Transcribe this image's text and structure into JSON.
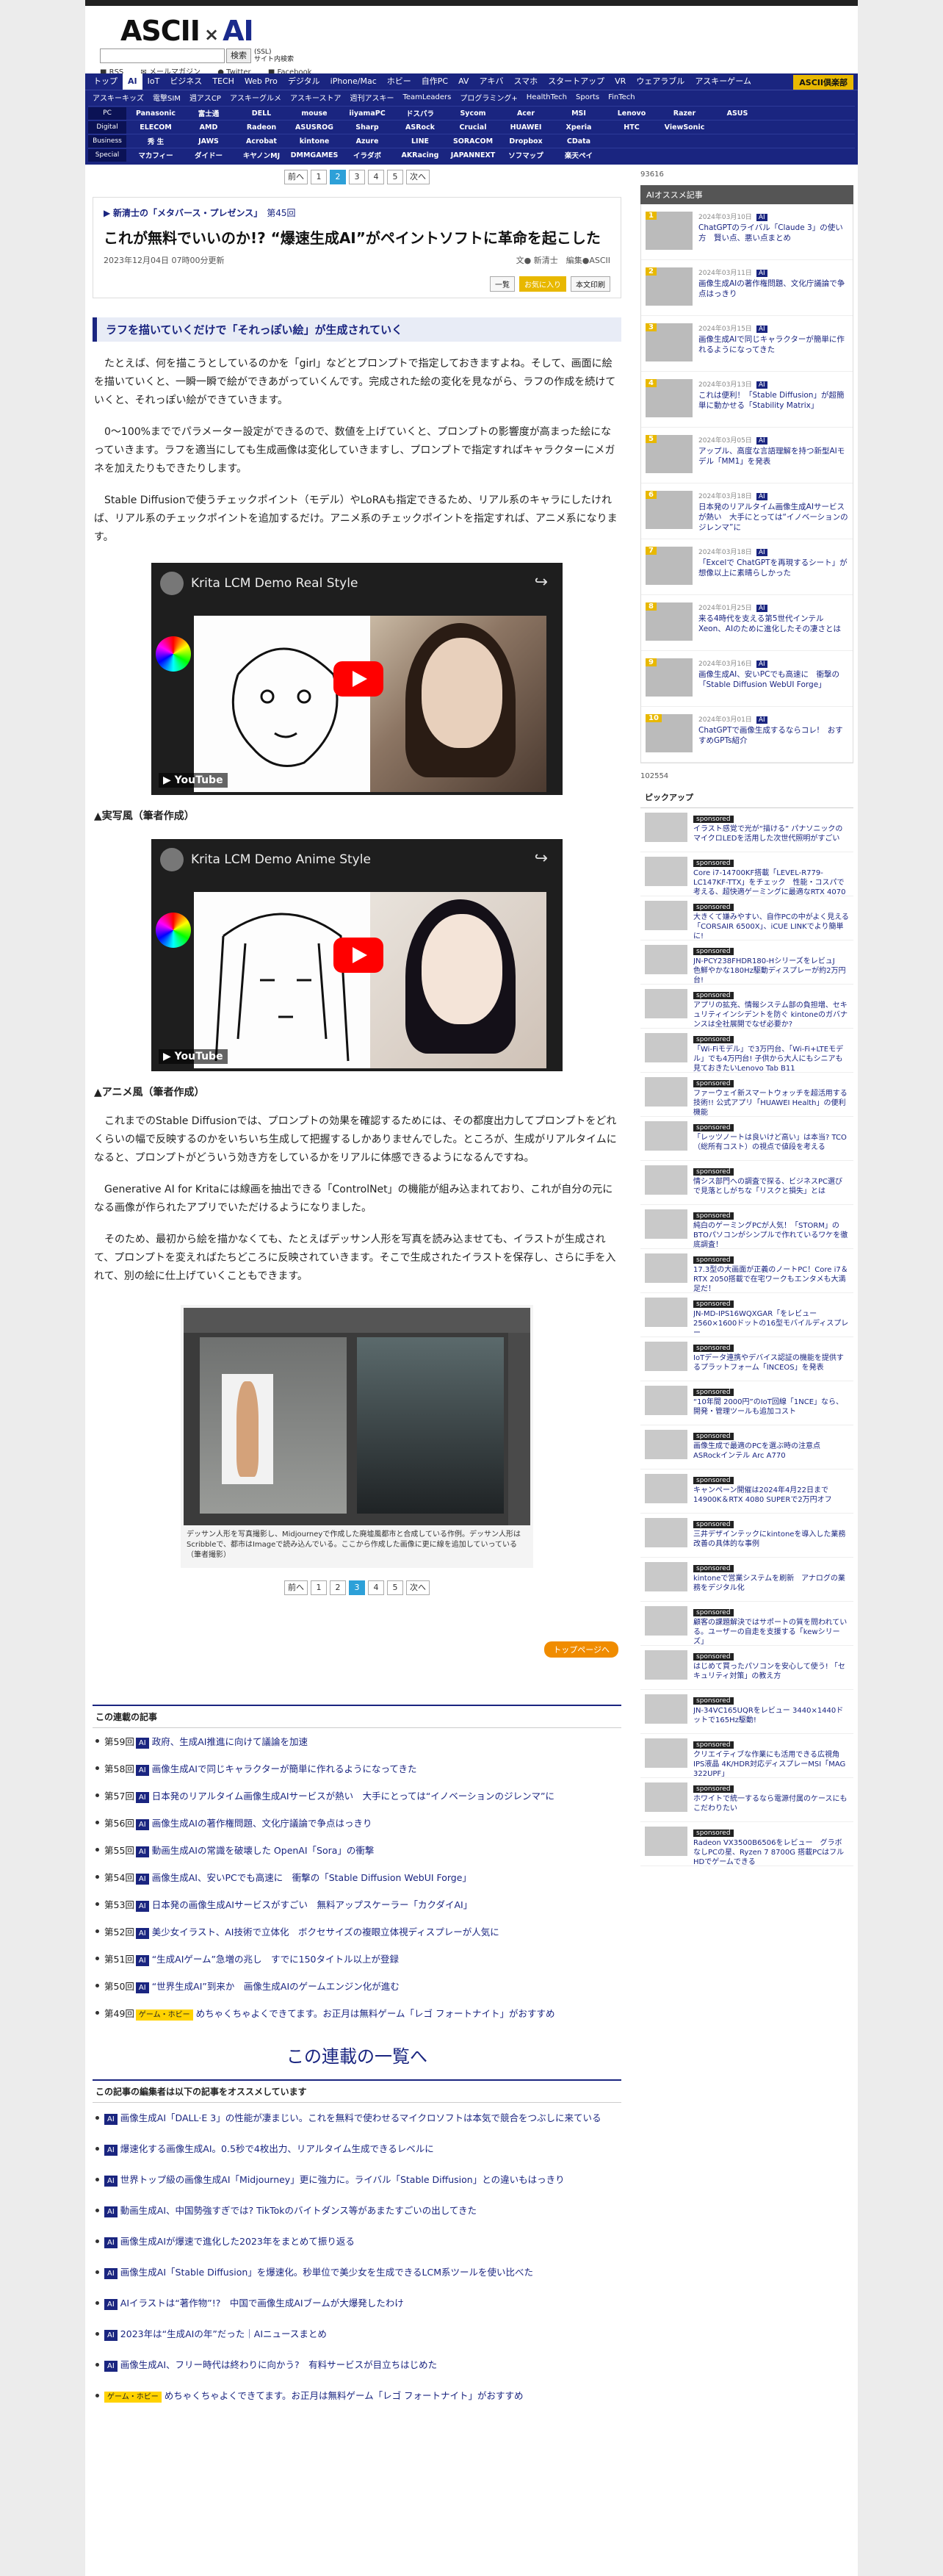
{
  "header": {
    "logo_left": "ASCII",
    "logo_mid": "×",
    "logo_right": "AI",
    "search_button": "検索",
    "search_sub": "サイト内検索",
    "search_sub2": "(SSL)",
    "social": [
      "RSS",
      "メールマガジン",
      "Twitter",
      "Facebook"
    ]
  },
  "nav1": [
    "トップ",
    "AI",
    "IoT",
    "ビジネス",
    "TECH",
    "Web Pro",
    "デジタル",
    "iPhone/Mac",
    "ホビー",
    "自作PC",
    "AV",
    "アキバ",
    "スマホ",
    "スタートアップ",
    "VR",
    "ウェアラブル",
    "アスキーゲーム"
  ],
  "nav1_club": "ASCII倶楽部",
  "nav2": [
    "アスキーキッズ",
    "電撃SIM",
    "週アスCP",
    "アスキーグルメ",
    "アスキーストア",
    "週刊アスキー",
    "TeamLeaders",
    "プログラミング+",
    "HealthTech",
    "Sports",
    "FinTech"
  ],
  "brands": [
    {
      "label": "PC",
      "items": [
        "Panasonic",
        "富士通",
        "DELL",
        "mouse",
        "iiyamaPC",
        "ドスパラ",
        "Sycom",
        "Acer",
        "MSI",
        "Lenovo",
        "Razer",
        "ASUS"
      ]
    },
    {
      "label": "Digital",
      "items": [
        "ELECOM",
        "AMD",
        "Radeon",
        "ASUSROG",
        "Sharp",
        "ASRock",
        "Crucial",
        "HUAWEI",
        "Xperia",
        "HTC",
        "ViewSonic"
      ]
    },
    {
      "label": "Business",
      "items": [
        "秀 生",
        "JAWS",
        "Acrobat",
        "kintone",
        "Azure",
        "LINE",
        "SORACOM",
        "Dropbox",
        "CData"
      ]
    },
    {
      "label": "Special",
      "items": [
        "マカフィー",
        "ダイドー",
        "キヤノンMJ",
        "DMMGAMES",
        "イラダボ",
        "AKRacing",
        "JAPANNEXT",
        "ソフマップ",
        "楽天ペイ"
      ]
    }
  ],
  "pager": {
    "prev": "前へ",
    "pages": [
      "1",
      "2",
      "3",
      "4",
      "5"
    ],
    "current": "2",
    "next": "次へ"
  },
  "pager2": {
    "prev": "前へ",
    "pages": [
      "1",
      "2",
      "3",
      "4",
      "5"
    ],
    "current": "3",
    "next": "次へ"
  },
  "article": {
    "series": "新清士の「メタバース・プレゼンス」",
    "series_no": "第45回",
    "title": "これが無料でいいのか!? “爆速生成AI”がペイントソフトに革命を起こした",
    "date": "2023年12月04日 07時00分更新",
    "author": "文● 新清士　編集●ASCII",
    "share_list": "一覧",
    "share_fav": "お気に入り",
    "share_text": "本文印刷",
    "heading": "ラフを描いていくだけで「それっぽい絵」が生成されていく",
    "p1": "たとえば、何を描こうとしているのかを「girl」などとプロンプトで指定しておきますよね。そして、画面に絵を描いていくと、一瞬一瞬で絵ができあがっていくんです。完成された絵の変化を見ながら、ラフの作成を続けていくと、それっぽい絵ができていきます。",
    "p2": "0〜100%まででパラメーター設定ができるので、数値を上げていくと、プロンプトの影響度が高まった絵になっていきます。ラフを適当にしても生成画像は変化していきますし、プロンプトで指定すればキャラクターにメガネを加えたりもできたりします。",
    "p3": "Stable Diffusionで使うチェックポイント（モデル）やLoRAも指定できるため、リアル系のキャラにしたければ、リアル系のチェックポイントを追加するだけ。アニメ系のチェックポイントを指定すれば、アニメ系になります。",
    "video1_title": "Krita LCM Demo Real Style",
    "cap1": "▲実写風（筆者作成）",
    "video2_title": "Krita LCM Demo Anime Style",
    "cap2": "▲アニメ風（筆者作成）",
    "p4": "これまでのStable Diffusionでは、プロンプトの効果を確認するためには、その都度出力してプロンプトをどれくらいの幅で反映するのかをいちいち生成して把握するしかありませんでした。ところが、生成がリアルタイムになると、プロンプトがどういう効き方をしているかをリアルに体感できるようになるんですね。",
    "p5": "Generative AI for Kritaには線画を抽出できる「ControlNet」の機能が組み込まれており、これが自分の元になる画像が作られたアプリでいただけるようになりました。",
    "p6": "そのため、最初から絵を描かなくても、たとえばデッサン人形を写真を読み込ませても、イラストが生成されて、プロンプトを変えればたちどころに反映されていきます。そこで生成されたイラストを保存し、さらに手を入れて、別の絵に仕上げていくこともできます。",
    "fig_caption": "デッサン人形を写真撮影し、Midjourneyで作成した廃墟風都市と合成している作例。デッサン人形はScribbleで、都市はImageで読み込んでいる。ここから作成した画像に更に線を追加していっている（筆者撮影）"
  },
  "top_button": "トップページへ",
  "related": {
    "heading": "この連載の記事",
    "items": [
      {
        "no": "第59回",
        "tag": "AI",
        "title": "政府、生成AI推進に向けて議論を加速"
      },
      {
        "no": "第58回",
        "tag": "AI",
        "title": "画像生成AIで同じキャラクターが簡単に作れるようになってきた"
      },
      {
        "no": "第57回",
        "tag": "AI",
        "title": "日本発のリアルタイム画像生成AIサービスが熱い　大手にとっては“イノベーションのジレンマ”に"
      },
      {
        "no": "第56回",
        "tag": "AI",
        "title": "画像生成AIの著作権問題、文化庁議論で争点はっきり"
      },
      {
        "no": "第55回",
        "tag": "AI",
        "title": "動画生成AIの常識を破壊した OpenAI「Sora」の衝撃"
      },
      {
        "no": "第54回",
        "tag": "AI",
        "title": "画像生成AI、安いPCでも高速に　衝撃の「Stable Diffusion WebUI Forge」"
      },
      {
        "no": "第53回",
        "tag": "AI",
        "title": "日本発の画像生成AIサービスがすごい　無料アップスケーラー「カクダイAI」"
      },
      {
        "no": "第52回",
        "tag": "AI",
        "title": "美少女イラスト、AI技術で立体化　ボクセサイズの複眼立体視ディスプレーが人気に"
      },
      {
        "no": "第51回",
        "tag": "AI",
        "title": "“生成AIゲーム”急増の兆し　すでに150タイトル以上が登録"
      },
      {
        "no": "第50回",
        "tag": "AI",
        "title": "“世界生成AI”到来か　画像生成AIのゲームエンジン化が進む"
      },
      {
        "no": "第49回",
        "tag": "ゲーム・ホビー",
        "title": "めちゃくちゃよくできてます。お正月は無料ゲーム「レゴ フォートナイト」がおすすめ"
      }
    ]
  },
  "series_link": "この連載の一覧へ",
  "recommend": {
    "heading": "この記事の編集者は以下の記事をオススメしています",
    "items": [
      {
        "tag": "AI",
        "title": "画像生成AI「DALL·E 3」の性能が凄まじい。これを無料で使わせるマイクロソフトは本気で競合をつぶしに来ている"
      },
      {
        "tag": "AI",
        "title": "爆速化する画像生成AI。0.5秒で4枚出力、リアルタイム生成できるレベルに"
      },
      {
        "tag": "AI",
        "title": "世界トップ級の画像生成AI「Midjourney」更に強力に。ライバル「Stable Diffusion」との違いもはっきり"
      },
      {
        "tag": "AI",
        "title": "動画生成AI、中国勢強すぎでは? TikTokのバイトダンス等があまたすごいの出してきた"
      },
      {
        "tag": "AI",
        "title": "画像生成AIが爆速で進化した2023年をまとめて振り返る"
      },
      {
        "tag": "AI",
        "title": "画像生成AI「Stable Diffusion」を爆速化。秒単位で美少女を生成できるLCM系ツールを使い比べた"
      },
      {
        "tag": "AI",
        "title": "AIイラストは“著作物”!?　中国で画像生成AIブームが大爆発したわけ"
      },
      {
        "tag": "AI",
        "title": "2023年は“生成AIの年”だった｜AIニュースまとめ"
      },
      {
        "tag": "AI",
        "title": "画像生成AI、フリー時代は終わりに向かう?　有料サービスが目立ちはじめた"
      },
      {
        "tag": "ゲーム・ホビー",
        "title": "めちゃくちゃよくできてます。お正月は無料ゲーム「レゴ フォートナイト」がおすすめ"
      }
    ]
  },
  "side": {
    "ad1": "93616",
    "rank_heading": "AIオススメ記事",
    "ranking": [
      {
        "n": "1",
        "date": "2024年03月10日",
        "title": "ChatGPTのライバル「Claude 3」の使い方　賢い点、悪い点まとめ"
      },
      {
        "n": "2",
        "date": "2024年03月11日",
        "title": "画像生成AIの著作権問題、文化庁議論で争点はっきり"
      },
      {
        "n": "3",
        "date": "2024年03月15日",
        "title": "画像生成AIで同じキャラクターが簡単に作れるようになってきた"
      },
      {
        "n": "4",
        "date": "2024年03月13日",
        "title": "これは便利！「Stable Diffusion」が超簡単に動かせる「Stability Matrix」"
      },
      {
        "n": "5",
        "date": "2024年03月05日",
        "title": "アップル、高度な言語理解を持つ新型AIモデル「MM1」を発表"
      },
      {
        "n": "6",
        "date": "2024年03月18日",
        "title": "日本発のリアルタイム画像生成AIサービスが熱い　大手にとっては“イノベーションのジレンマ”に"
      },
      {
        "n": "7",
        "date": "2024年03月18日",
        "title": "「Excelで ChatGPTを再現するシート」が想像以上に素晴らしかった"
      },
      {
        "n": "8",
        "date": "2024年01月25日",
        "title": "来る4時代を支える第5世代インテル Xeon、AIのために進化したその凄さとは"
      },
      {
        "n": "9",
        "date": "2024年03月16日",
        "title": "画像生成AI、安いPCでも高速に　衝撃の「Stable Diffusion WebUI Forge」"
      },
      {
        "n": "10",
        "date": "2024年03月01日",
        "title": "ChatGPTで画像生成するならコレ!　おすすめGPTs紹介"
      }
    ],
    "ad2": "102554",
    "pick_heading": "ピックアップ",
    "sponsored": "sponsored",
    "picks": [
      "イラスト感覚で光が“描ける” パナソニックのマイクロLEDを活用した次世代照明がすごい",
      "Core i7-14700KF搭載「LEVEL-R779-LC147KF-TTX」をチェック　性能・コスパで考える、超快適ゲーミングに最適なRTX 4070 SUPER",
      "大きくて嫌みやすい、自作PCの中がよく見える「CORSAIR 6500X」、iCUE LINKでより簡単に!",
      "JN-PCY238FHDR180-HシリーズをレビュJ　色鮮やかな180Hz駆動ディスプレーが約2万円台!",
      "アプリの拡充、情報システム部の負担増、セキュリティインシデントを防ぐ kintoneのガバナンスは全社展開でなぜ必要か?",
      "「Wi-Fiモデル」で3万円台、「Wi-Fi+LTEモデル」でも4万円台! 子供から大人にもシニアも見ておきたいLenovo Tab B11",
      "ファーウェイ新スマートウォッチを超活用する技術!! 公式アプリ「HUAWEI Health」の便利機能",
      "「レッツノートは良いけど高い」は本当? TCO（総所有コスト）の視点で値段を考える",
      "情シス部門への調査で探る、ビジネスPC選びで見落としがちな「リスクと損失」とは",
      "純白のゲーミングPCが人気！「STORM」のBTOパソコンがシンプルで作れているワケを徹底調査！",
      "17.3型の大画面が正義のノートPC！Core i7＆RTX 2050搭載で在宅ワークもエンタメも大満足だ！",
      "JN-MD-IPS16WQXGAR「をレビュー 2560×1600ドットの16型モバイルディスプレー",
      "IoTデータ連携やデバイス認証の機能を提供するプラットフォーム「INCEOS」を発表",
      "“10年間 2000円”のIoT回線「1NCE」なら、開発・管理ツールも追加コスト",
      "画像生成で最適のPCを選ぶ時の注意点　ASRockインテル Arc A770",
      "キャンペーン開催は2024年4月22日まで 14900K＆RTX 4080 SUPERで2万円オフ",
      "三井デザインテックにkintoneを導入した業務改善の具体的な事例",
      "kintoneで営業システムを刷新　アナログの業務をデジタル化",
      "顧客の課題解決ではサポートの質を問われている。ユーザーの自走を支援する「kewシリーズ」",
      "はじめて買ったパソコンを安心して使う! 「セキュリティ対策」の教え方",
      "JN-34VC165UQRをレビュー 3440×1440ドットで165Hz駆動!",
      "クリエイティブな作業にも活用できる広視角IPS液晶 4K/HDR対応ディスプレーMSI「MAG 322UPF」",
      "ホワイトで統一するなら電源付属のケースにもこだわりたい",
      "Radeon VX3500B6506をレビュー　グラボなしPCの星、Ryzen 7 8700G 搭載PCはフルHDでゲームできる"
    ]
  }
}
